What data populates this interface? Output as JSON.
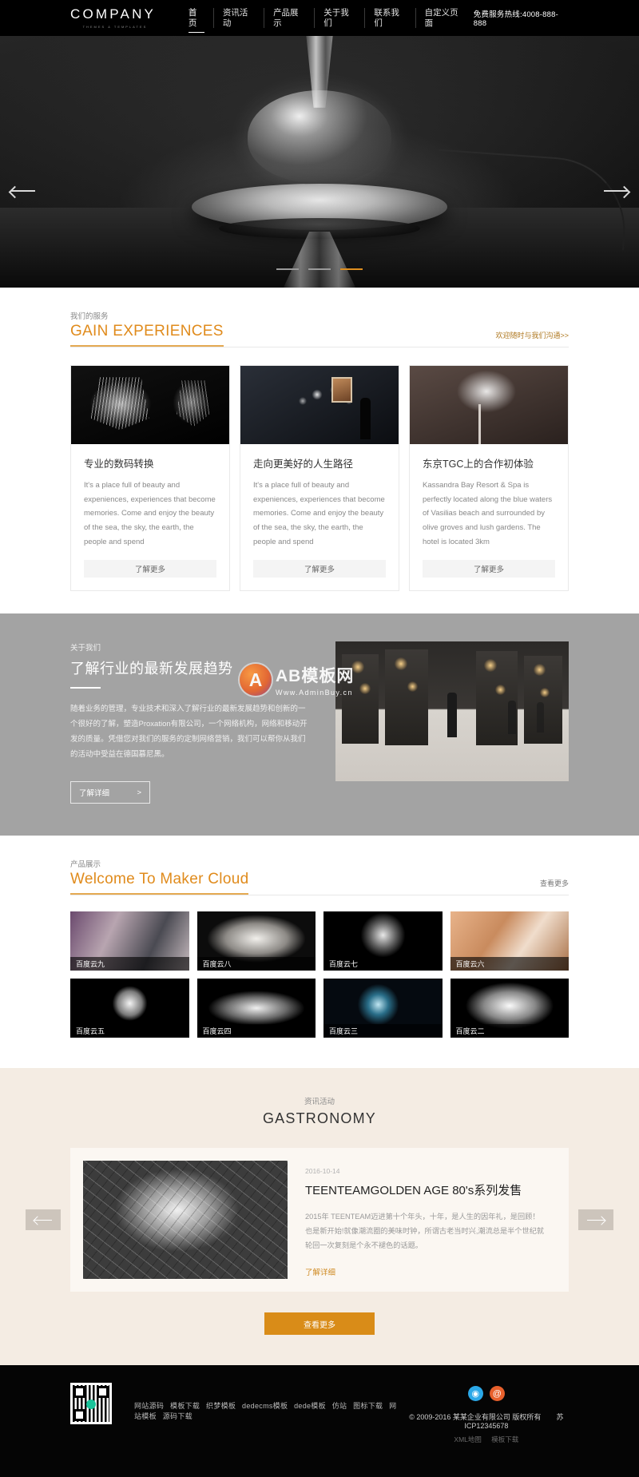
{
  "header": {
    "logo_main": "COMPANY",
    "logo_sub": "THEMES & TEMPLATES",
    "nav": [
      {
        "label": "首页",
        "active": true
      },
      {
        "label": "资讯活动",
        "active": false
      },
      {
        "label": "产品展示",
        "active": false
      },
      {
        "label": "关于我们",
        "active": false
      },
      {
        "label": "联系我们",
        "active": false
      },
      {
        "label": "自定义页面",
        "active": false
      }
    ],
    "hotline": "免费服务热线:4008-888-888"
  },
  "hero": {
    "prev_label": "上一张",
    "next_label": "下一张",
    "dots": [
      "1",
      "2",
      "3"
    ],
    "active_dot": 3,
    "active_color": "#e09020"
  },
  "services": {
    "sub": "我们的服务",
    "title": "GAIN EXPERIENCES",
    "more": "欢迎随时与我们沟通>>",
    "cards": [
      {
        "title": "专业的数码转换",
        "desc": "It's a place full of beauty and expeniences, experiences that become memories. Come and enjoy the beauty of the sea, the sky, the earth, the people and spend",
        "btn": "了解更多"
      },
      {
        "title": "走向更美好的人生路径",
        "desc": "It's a place full of beauty and expeniences, experiences that become memories. Come and enjoy the beauty of the sea, the sky, the earth, the people and spend",
        "btn": "了解更多"
      },
      {
        "title": "东京TGC上的合作初体验",
        "desc": "Kassandra Bay Resort & Spa is perfectly located along the blue waters of Vasilias beach and surrounded by olive groves and lush gardens. The hotel is located 3km",
        "btn": "了解更多"
      }
    ]
  },
  "about": {
    "sub": "关于我们",
    "title": "了解行业的最新发展趋势",
    "text": "随着业务的管理，专业技术和深入了解行业的最新发展趋势和创新的一个很好的了解，塑造Proxation有限公司，一个网络机构，网络和移动开发的质量。凭借您对我们的服务的定制网络营销，我们可以帮你从我们的活动中受益在德国慕尼黑。",
    "btn": "了解详细",
    "btn_arrow": ">",
    "watermark_badge": "A",
    "watermark_title": "AB模板网",
    "watermark_sub": "Www.AdminBuy.cn"
  },
  "products": {
    "sub": "产品展示",
    "title": "Welcome To Maker Cloud",
    "more": "查看更多",
    "items": [
      {
        "label": "百度云九",
        "cls": "p9"
      },
      {
        "label": "百度云八",
        "cls": "p8"
      },
      {
        "label": "百度云七",
        "cls": "p7"
      },
      {
        "label": "百度云六",
        "cls": "p6"
      },
      {
        "label": "百度云五",
        "cls": "p5"
      },
      {
        "label": "百度云四",
        "cls": "p4"
      },
      {
        "label": "百度云三",
        "cls": "p3"
      },
      {
        "label": "百度云二",
        "cls": "p2"
      }
    ]
  },
  "news": {
    "sub": "资讯活动",
    "title": "GASTRONOMY",
    "date": "2016-10-14",
    "headline": "TEENTEAMGOLDEN AGE 80's系列发售",
    "body": "2015年 TEENTEAM迈进第十个年头，十年，是人生的因年礼，是回顾！也是新开始!就像潮流圈的美味时钟，所谓古老当时兴,潮流总是半个世纪就轮回一次复刻是个永不褪色的话题。",
    "link": "了解详细",
    "prev_label": "上一条",
    "next_label": "下一条",
    "more_btn": "查看更多",
    "more_btn_color": "#d98c18"
  },
  "footer": {
    "links": [
      "网站源码",
      "模板下载",
      "织梦模板",
      "dedecms模板",
      "dede模板",
      "仿站",
      "图标下载",
      "网站模板",
      "源码下载"
    ],
    "socials": [
      {
        "name": "qq-icon",
        "glyph": "◉"
      },
      {
        "name": "weibo-icon",
        "glyph": "@"
      }
    ],
    "copyright": "© 2009-2016 某某企业有限公司 版权所有",
    "icp": "苏ICP12345678",
    "sub_links": [
      "XML地图",
      "模板下载"
    ]
  }
}
